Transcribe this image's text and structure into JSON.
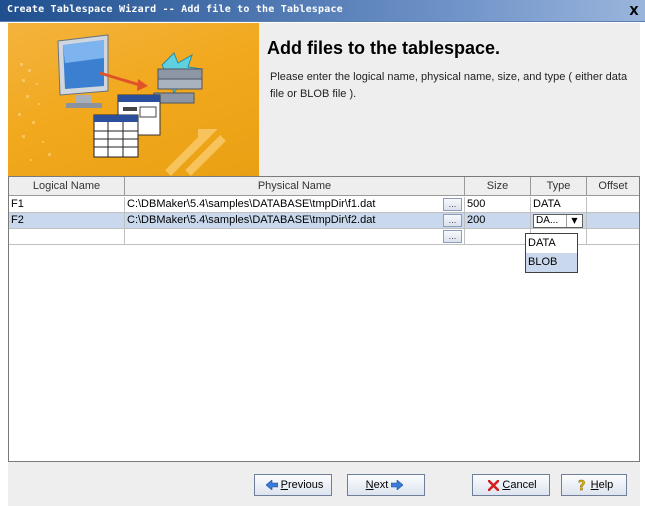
{
  "window": {
    "title": "Create Tablespace Wizard -- Add file to the Tablespace",
    "close_label": "X"
  },
  "banner": {
    "heading": "Add files to the tablespace.",
    "description": "Please enter the logical name, physical name, size, and type ( either data file or BLOB file )."
  },
  "table": {
    "columns": [
      "Logical Name",
      "Physical Name",
      "Size",
      "Type",
      "Offset"
    ],
    "rows": [
      {
        "logical": "F1",
        "physical": "C:\\DBMaker\\5.4\\samples\\DATABASE\\tmpDir\\f1.dat",
        "size": "500",
        "type": "DATA",
        "offset": ""
      },
      {
        "logical": "F2",
        "physical": "C:\\DBMaker\\5.4\\samples\\DATABASE\\tmpDir\\f2.dat",
        "size": "200",
        "type": "DA...",
        "offset": ""
      },
      {
        "logical": "",
        "physical": "",
        "size": "",
        "type": "",
        "offset": ""
      }
    ],
    "browse_label": "...",
    "type_options": [
      "DATA",
      "BLOB"
    ],
    "type_highlighted": "BLOB"
  },
  "buttons": {
    "previous": {
      "prefix": "",
      "mnemonic": "P",
      "rest": "revious"
    },
    "next": {
      "prefix": "",
      "mnemonic": "N",
      "rest": "ext"
    },
    "cancel": {
      "prefix": "",
      "mnemonic": "C",
      "rest": "ancel"
    },
    "help": {
      "prefix": "",
      "mnemonic": "H",
      "rest": "elp"
    }
  },
  "icons": {
    "previous": "left-arrow-icon",
    "next": "right-arrow-icon",
    "cancel": "red-x-icon",
    "help": "question-mark-icon"
  },
  "colors": {
    "titlebar": "#1f4f8f",
    "banner_art": "#f2a81c",
    "selection": "#c9d8ec"
  }
}
